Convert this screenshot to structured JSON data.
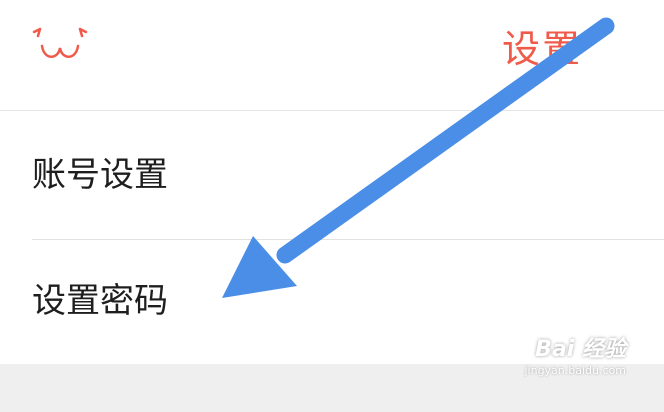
{
  "header": {
    "logo_icon": "cat-face-icon",
    "title": "设置"
  },
  "menu": {
    "items": [
      {
        "label": "账号设置"
      },
      {
        "label": "设置密码"
      }
    ]
  },
  "annotation": {
    "icon": "blue-arrow-pointer"
  },
  "watermark": {
    "logo": "Bai 经验",
    "url": "jingyan.baidu.com"
  },
  "colors": {
    "accent": "#f05a4a",
    "arrow": "#4a8ee8",
    "divider": "#e2e2e2"
  }
}
